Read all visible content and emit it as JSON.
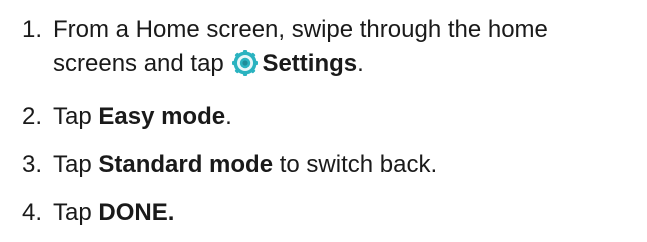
{
  "steps": [
    {
      "number": "1.",
      "line1": "From a Home screen, swipe through the home",
      "line2_before": "screens and tap",
      "icon": "settings-gear-icon",
      "bold": "Settings",
      "after": "."
    },
    {
      "number": "2.",
      "before": "Tap",
      "bold": "Easy mode",
      "after": "."
    },
    {
      "number": "3.",
      "before": "Tap",
      "bold": "Standard mode",
      "after": "to switch back."
    },
    {
      "number": "4.",
      "before": "Tap",
      "bold": "DONE.",
      "after": ""
    }
  ],
  "colors": {
    "text": "#1a1a1a",
    "icon_teal": "#2bb3c0",
    "icon_dark": "#1e8c99"
  }
}
